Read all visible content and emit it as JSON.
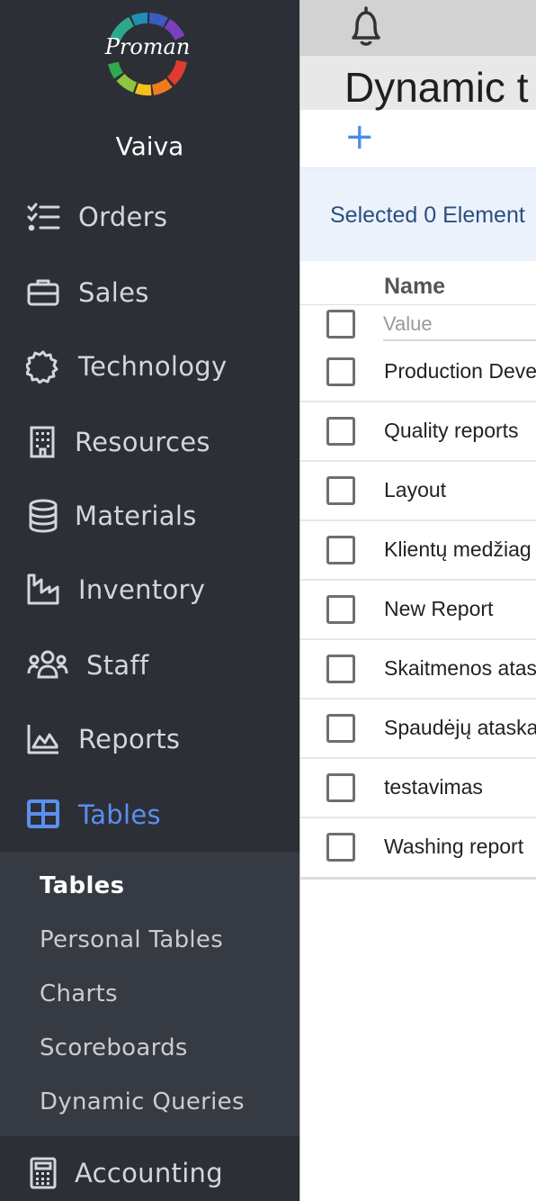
{
  "brand": {
    "logo_text": "Proman"
  },
  "user": {
    "name": "Vaiva"
  },
  "nav": {
    "orders": "Orders",
    "sales": "Sales",
    "technology": "Technology",
    "resources": "Resources",
    "materials": "Materials",
    "inventory": "Inventory",
    "staff": "Staff",
    "reports": "Reports",
    "tables": "Tables",
    "accounting": "Accounting"
  },
  "submenu": {
    "tables": "Tables",
    "personal_tables": "Personal Tables",
    "charts": "Charts",
    "scoreboards": "Scoreboards",
    "dynamic_queries": "Dynamic Queries"
  },
  "page": {
    "title": "Dynamic t",
    "add_label": "+"
  },
  "selection": {
    "text": "Selected 0 Element"
  },
  "table": {
    "column_name": "Name",
    "filter_placeholder": "Value",
    "rows": [
      "Production Deve",
      "Quality reports",
      "Layout",
      "Klientų medžiag",
      "New Report",
      "Skaitmenos atas",
      "Spaudėjų ataska",
      "testavimas",
      "Washing report"
    ]
  },
  "colors": {
    "sidebar_bg": "#2c2f36",
    "submenu_bg": "#363a42",
    "accent": "#5b8ff0",
    "selection_bg": "#ecf2fb"
  },
  "icons": {
    "orders": "checklist-icon",
    "sales": "briefcase-icon",
    "technology": "gear-icon",
    "resources": "building-icon",
    "materials": "database-icon",
    "inventory": "factory-icon",
    "staff": "users-icon",
    "reports": "chart-area-icon",
    "tables": "table-icon",
    "accounting": "calculator-icon",
    "notifications": "bell-icon"
  }
}
